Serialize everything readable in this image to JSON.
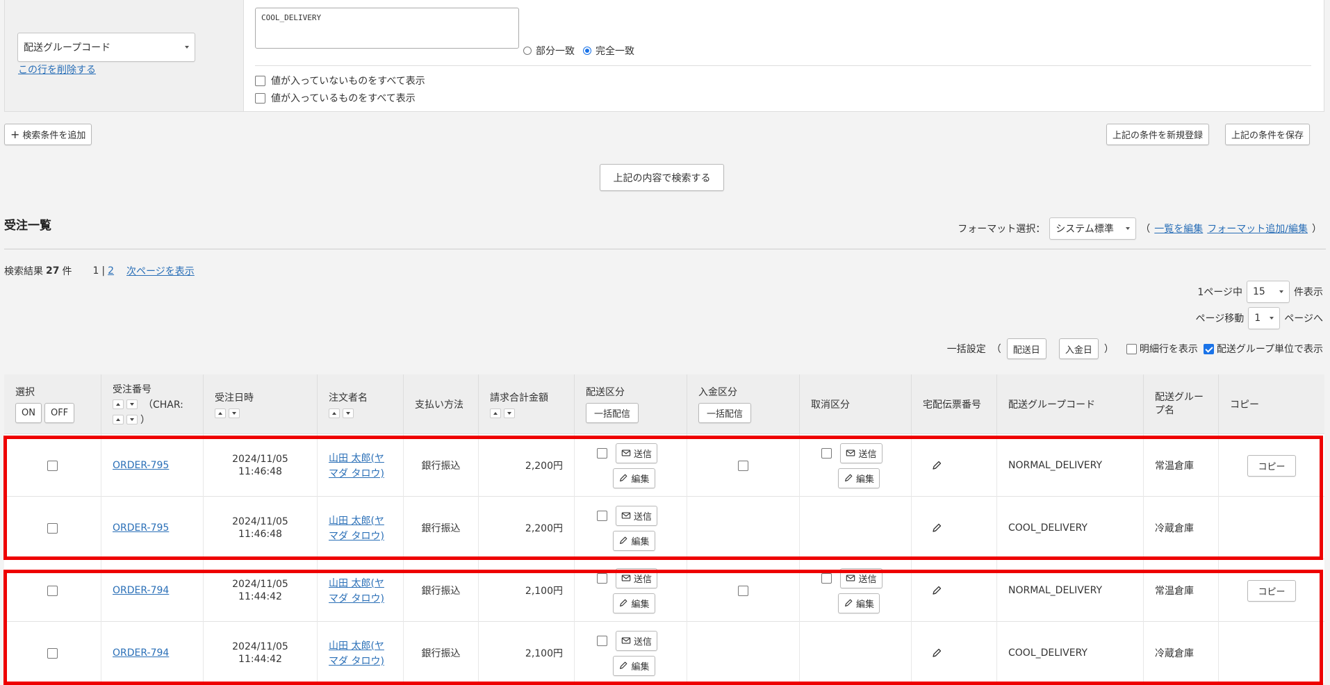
{
  "filter": {
    "field_select": "配送グループコード",
    "delete_row_link": "この行を削除する",
    "textarea_value": "COOL_DELIVERY",
    "match_partial": "部分一致",
    "match_exact": "完全一致",
    "option_empty": "値が入っていないものをすべて表示",
    "option_filled": "値が入っているものをすべて表示"
  },
  "actions": {
    "add_condition": "検索条件を追加",
    "save_as_new": "上記の条件を新規登録",
    "save": "上記の条件を保存",
    "search": "上記の内容で検索する"
  },
  "list": {
    "title": "受注一覧",
    "format_label": "フォーマット選択：",
    "format_value": "システム標準",
    "paren_open": "（",
    "edit_list_link": "一覧を編集",
    "format_edit_link": "フォーマット追加/編集",
    "paren_close": "）",
    "results_prefix": "検索結果",
    "results_count": "27",
    "results_suffix": "件",
    "page_current": "1",
    "page_sep": "|",
    "page_2": "2",
    "next_page": "次ページを表示",
    "per_page_label": "1ページ中",
    "per_page_value": "15",
    "per_page_suffix": "件表示",
    "page_move_label": "ページ移動",
    "page_move_value": "1",
    "page_move_suffix": "ページへ",
    "bulk_label": "一括設定",
    "bulk_open": "（",
    "bulk_ship_date": "配送日",
    "bulk_pay_date": "入金日",
    "bulk_close": "）",
    "show_detail_rows": "明細行を表示",
    "show_by_group": "配送グループ単位で表示"
  },
  "table": {
    "headers": {
      "select": "選択",
      "select_on": "ON",
      "select_off": "OFF",
      "order_no": "受注番号",
      "order_no_char": "（CHAR:",
      "order_no_close": "）",
      "order_date": "受注日時",
      "customer": "注文者名",
      "payment": "支払い方法",
      "total": "請求合計金額",
      "ship_status": "配送区分",
      "bulk_send": "一括配信",
      "pay_status": "入金区分",
      "cancel_status": "取消区分",
      "tracking": "宅配伝票番号",
      "group_code": "配送グループコード",
      "group_name": "配送グループ名",
      "copy": "コピー"
    },
    "send_label": "送信",
    "edit_label": "編集",
    "copy_label": "コピー",
    "rows": [
      {
        "order": "ORDER-795",
        "date": "2024/11/05",
        "time": "11:46:48",
        "customer_1": "山田 太郎(ヤ",
        "customer_2": "マダ タロウ)",
        "payment": "銀行振込",
        "total": "2,200円",
        "group_code": "NORMAL_DELIVERY",
        "group_name": "常温倉庫",
        "first": true
      },
      {
        "order": "ORDER-795",
        "date": "2024/11/05",
        "time": "11:46:48",
        "customer_1": "山田 太郎(ヤ",
        "customer_2": "マダ タロウ)",
        "payment": "銀行振込",
        "total": "2,200円",
        "group_code": "COOL_DELIVERY",
        "group_name": "冷蔵倉庫",
        "first": false
      },
      {
        "order": "ORDER-794",
        "date": "2024/11/05",
        "time": "11:44:42",
        "customer_1": "山田 太郎(ヤ",
        "customer_2": "マダ タロウ)",
        "payment": "銀行振込",
        "total": "2,100円",
        "group_code": "NORMAL_DELIVERY",
        "group_name": "常温倉庫",
        "first": true
      },
      {
        "order": "ORDER-794",
        "date": "2024/11/05",
        "time": "11:44:42",
        "customer_1": "山田 太郎(ヤ",
        "customer_2": "マダ タロウ)",
        "payment": "銀行振込",
        "total": "2,100円",
        "group_code": "COOL_DELIVERY",
        "group_name": "冷蔵倉庫",
        "first": false
      }
    ]
  },
  "colors": {
    "highlight": "#ee0000",
    "link": "#2a6fb7",
    "checkbox_checked": "#1a73e8"
  }
}
